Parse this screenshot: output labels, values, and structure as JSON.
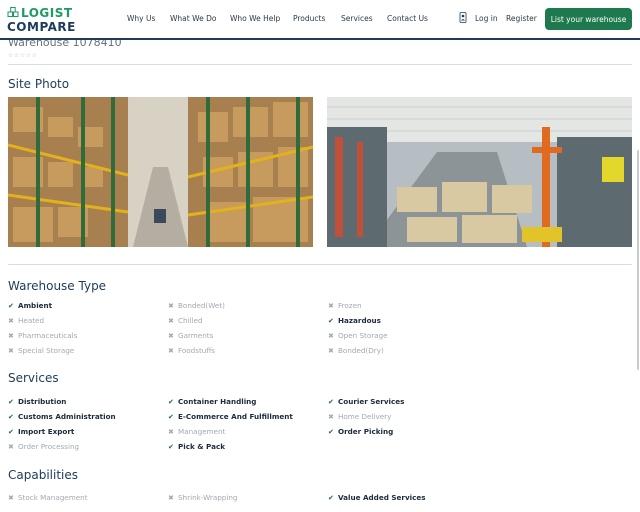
{
  "header": {
    "logo_top": "LOGIST",
    "logo_bottom": "COMPARE",
    "nav": [
      "Why Us",
      "What We Do",
      "Who We Help",
      "Products",
      "Services",
      "Contact Us"
    ],
    "login": "Log in",
    "register": "Register",
    "cta": "List your warehouse"
  },
  "warehouse": {
    "title": "Warehouse 1078410",
    "stars": "☆☆☆☆☆"
  },
  "site_photo": {
    "heading": "Site Photo"
  },
  "warehouse_type": {
    "heading": "Warehouse Type",
    "items": [
      {
        "label": "Ambient",
        "on": true
      },
      {
        "label": "Bonded(Wet)",
        "on": false
      },
      {
        "label": "Frozen",
        "on": false
      },
      {
        "label": "Heated",
        "on": false
      },
      {
        "label": "Chilled",
        "on": false
      },
      {
        "label": "Hazardous",
        "on": true
      },
      {
        "label": "Pharmaceuticals",
        "on": false
      },
      {
        "label": "Garments",
        "on": false
      },
      {
        "label": "Open Storage",
        "on": false
      },
      {
        "label": "Special Storage",
        "on": false
      },
      {
        "label": "Foodstuffs",
        "on": false
      },
      {
        "label": "Bonded(Dry)",
        "on": false
      }
    ]
  },
  "services": {
    "heading": "Services",
    "items": [
      {
        "label": "Distribution",
        "on": true
      },
      {
        "label": "Container Handling",
        "on": true
      },
      {
        "label": "Courier Services",
        "on": true
      },
      {
        "label": "Customs Administration",
        "on": true
      },
      {
        "label": "E-Commerce And Fulfillment",
        "on": true
      },
      {
        "label": "Home Delivery",
        "on": false
      },
      {
        "label": "Import Export",
        "on": true
      },
      {
        "label": "Management",
        "on": false
      },
      {
        "label": "Order Picking",
        "on": true
      },
      {
        "label": "Order Processing",
        "on": false
      },
      {
        "label": "Pick & Pack",
        "on": true
      }
    ]
  },
  "capabilities": {
    "heading": "Capabilities",
    "items": [
      {
        "label": "Stock Management",
        "on": false
      },
      {
        "label": "Shrink-Wrapping",
        "on": false
      },
      {
        "label": "Value Added Services",
        "on": true
      }
    ]
  },
  "marks": {
    "on": "✔",
    "off": "✖"
  },
  "colors": {
    "brand_green": "#1e7a4e",
    "brand_navy": "#1d3b5c"
  }
}
